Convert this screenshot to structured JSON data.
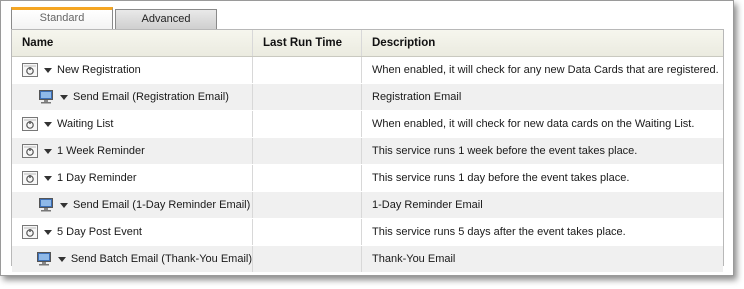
{
  "tabs": [
    {
      "label": "Standard",
      "active": true
    },
    {
      "label": "Advanced",
      "active": false
    }
  ],
  "columns": {
    "name": "Name",
    "last_run": "Last Run Time",
    "description": "Description"
  },
  "rows": [
    {
      "name": "New Registration",
      "last_run": "",
      "description": "When enabled, it will check for any new Data Cards that are registered.",
      "icon": "service-icon",
      "indent": 0
    },
    {
      "name": "Send Email (Registration Email)",
      "last_run": "",
      "description": "Registration Email",
      "icon": "email-computer-icon",
      "indent": 1
    },
    {
      "name": "Waiting List",
      "last_run": "",
      "description": "When enabled, it will check for new data cards on the Waiting List.",
      "icon": "service-icon",
      "indent": 0
    },
    {
      "name": "1 Week Reminder",
      "last_run": "",
      "description": "This service runs 1 week before the event takes place.",
      "icon": "service-icon",
      "indent": 0
    },
    {
      "name": "1 Day Reminder",
      "last_run": "",
      "description": "This service runs 1 day before the event takes place.",
      "icon": "service-icon",
      "indent": 0
    },
    {
      "name": "Send Email (1-Day Reminder Email)",
      "last_run": "",
      "description": "1-Day Reminder Email",
      "icon": "email-computer-icon",
      "indent": 1
    },
    {
      "name": "5 Day Post Event",
      "last_run": "",
      "description": "This service runs 5 days after the event takes place.",
      "icon": "service-icon",
      "indent": 0
    },
    {
      "name": "Send Batch Email (Thank-You Email)",
      "last_run": "",
      "description": "Thank-You Email",
      "icon": "email-computer-icon",
      "indent": 1
    }
  ],
  "colors": {
    "active_tab_accent": "#f5a623",
    "header_bg": "#ebebe0",
    "alt_row_bg": "#f0f0f0"
  }
}
